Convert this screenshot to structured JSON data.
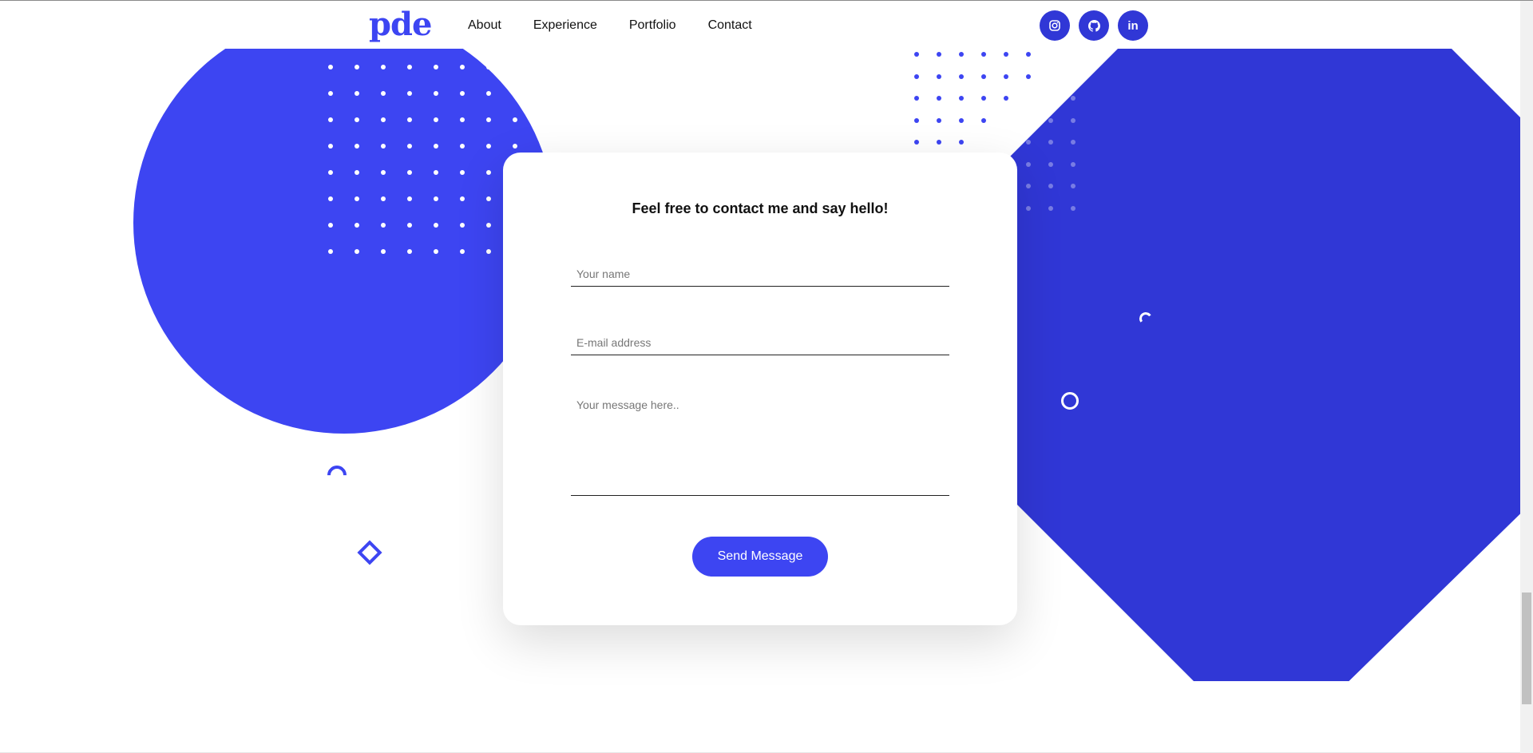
{
  "header": {
    "logo": "pde",
    "nav": [
      "About",
      "Experience",
      "Portfolio",
      "Contact"
    ],
    "social": [
      {
        "name": "instagram-icon",
        "glyph": "◎"
      },
      {
        "name": "github-icon",
        "glyph": "●"
      },
      {
        "name": "linkedin-icon",
        "glyph": "in"
      }
    ]
  },
  "contact": {
    "title": "Feel free to contact me and say hello!",
    "name_placeholder": "Your name",
    "email_placeholder": "E-mail address",
    "message_placeholder": "Your message here..",
    "send_label": "Send Message"
  },
  "colors": {
    "accent": "#3d45f2",
    "accent_dark": "#3037d6",
    "background": "#ffffff"
  }
}
